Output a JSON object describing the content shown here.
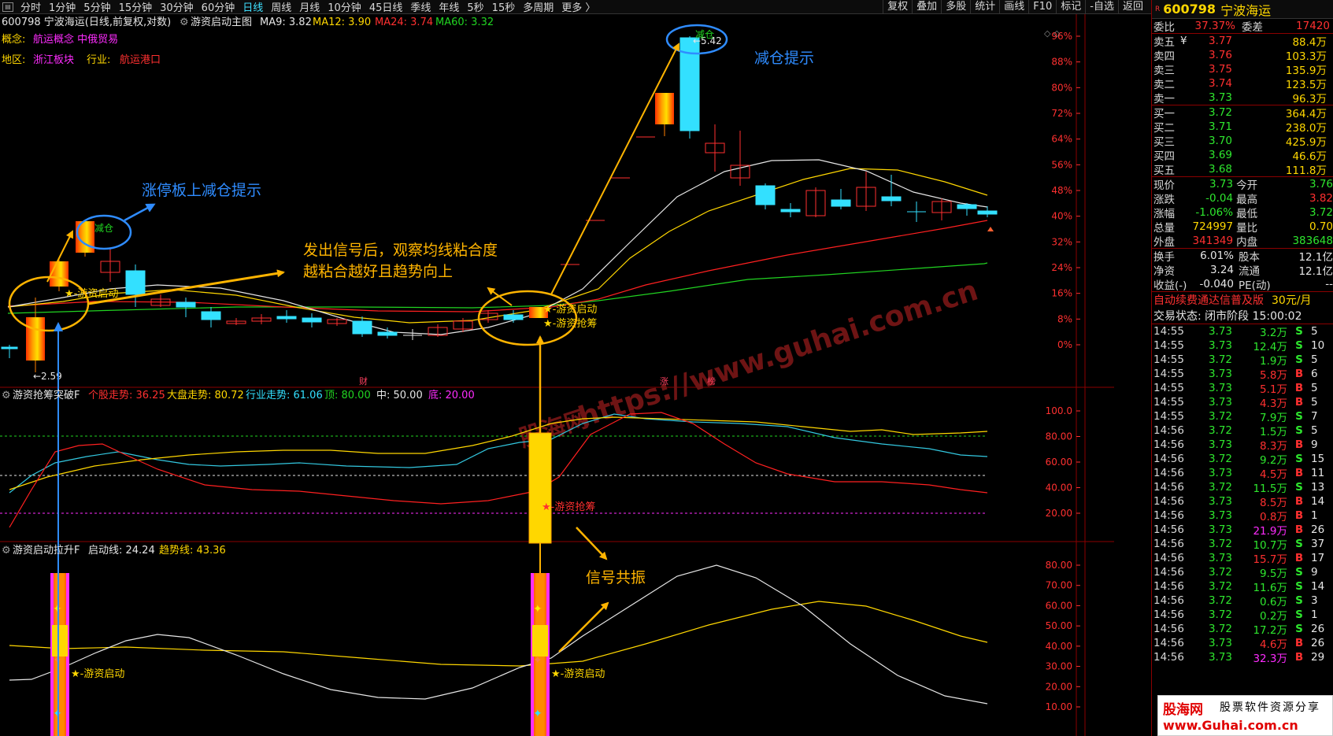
{
  "topbar": {
    "periods": [
      "分时",
      "1分钟",
      "5分钟",
      "15分钟",
      "30分钟",
      "60分钟",
      "日线",
      "周线",
      "月线",
      "10分钟",
      "45日线",
      "季线",
      "年线",
      "5秒",
      "15秒",
      "多周期",
      "更多 〉"
    ],
    "active_period": "日线",
    "tools": [
      "复权",
      "叠加",
      "多股",
      "统计",
      "画线",
      "F10",
      "标记",
      "-自选",
      "返回"
    ]
  },
  "chart": {
    "header": {
      "code_name": "600798 宁波海运(日线,前复权,对数)",
      "indicator": "游资启动主图",
      "ma9": "MA9: 3.82",
      "ma12": "MA12: 3.90",
      "ma24": "MA24: 3.74",
      "ma60": "MA60: 3.32"
    },
    "concept_label": "概念:",
    "concept_value": "航运概念 中俄贸易",
    "region_label": "地区:",
    "region_value": "浙江板块",
    "industry_label": "行业:",
    "industry_value": "航运港口",
    "price_axis": [
      "96%",
      "88%",
      "80%",
      "72%",
      "64%",
      "56%",
      "48%",
      "40%",
      "32%",
      "24%",
      "16%",
      "8%",
      "0%"
    ],
    "low_label": "←2.59",
    "high_label": "←5.42",
    "reduce_label": "减仓",
    "signal_start": "★-游资启动",
    "signal_grab": "★-游资抢筹",
    "markers": [
      "财",
      "涨",
      "榜"
    ],
    "watermark": "https://www.guhai.com.cn",
    "watermark_small": "股海网"
  },
  "annotations": {
    "limit_up_reduce": "涨停板上减仓提示",
    "reduce_hint": "减仓提示",
    "observe_line1": "发出信号后，观察均线粘合度",
    "observe_line2": "越粘合越好且趋势向上",
    "resonance": "信号共振"
  },
  "panel2": {
    "title": "游资抢筹突破F",
    "stock_trend": "个股走势: 36.25",
    "market_trend": "大盘走势: 80.72",
    "industry_trend": "行业走势: 61.06",
    "top": "顶: 80.00",
    "mid": "中: 50.00",
    "bottom": "底: 20.00",
    "axis": [
      "100.0",
      "80.00",
      "60.00",
      "40.00",
      "20.00"
    ]
  },
  "panel3": {
    "title": "游资启动拉升F",
    "start_line": "启动线: 24.24",
    "trend_line": "趋势线: 43.36",
    "axis": [
      "80.00",
      "70.00",
      "60.00",
      "50.00",
      "40.00",
      "30.00",
      "20.00",
      "10.00"
    ]
  },
  "quote": {
    "code": "600798",
    "name": "宁波海运",
    "r_mark": "R",
    "weibi_label": "委比",
    "weibi": "37.37%",
    "weicha_label": "委差",
    "weicha": "17420",
    "sell": [
      {
        "label": "卖五",
        "mark": "¥",
        "price": "3.77",
        "vol": "88.4万"
      },
      {
        "label": "卖四",
        "mark": "",
        "price": "3.76",
        "vol": "103.3万"
      },
      {
        "label": "卖三",
        "mark": "",
        "price": "3.75",
        "vol": "135.9万"
      },
      {
        "label": "卖二",
        "mark": "",
        "price": "3.74",
        "vol": "123.5万"
      },
      {
        "label": "卖一",
        "mark": "",
        "price": "3.73",
        "vol": "96.3万"
      }
    ],
    "buy": [
      {
        "label": "买一",
        "price": "3.72",
        "vol": "364.4万"
      },
      {
        "label": "买二",
        "price": "3.71",
        "vol": "238.0万"
      },
      {
        "label": "买三",
        "price": "3.70",
        "vol": "425.9万"
      },
      {
        "label": "买四",
        "price": "3.69",
        "vol": "46.6万"
      },
      {
        "label": "买五",
        "price": "3.68",
        "vol": "111.8万"
      }
    ],
    "stats": [
      {
        "l1": "现价",
        "v1": "3.73",
        "c1": "grn",
        "l2": "今开",
        "v2": "3.76",
        "c2": "grn"
      },
      {
        "l1": "涨跌",
        "v1": "-0.04",
        "c1": "grn",
        "l2": "最高",
        "v2": "3.82",
        "c2": "red"
      },
      {
        "l1": "涨幅",
        "v1": "-1.06%",
        "c1": "grn",
        "l2": "最低",
        "v2": "3.72",
        "c2": "grn"
      },
      {
        "l1": "总量",
        "v1": "724997",
        "c1": "yel",
        "l2": "量比",
        "v2": "0.70",
        "c2": "yel"
      },
      {
        "l1": "外盘",
        "v1": "341349",
        "c1": "red",
        "l2": "内盘",
        "v2": "383648",
        "c2": "grn"
      }
    ],
    "stats2": [
      {
        "l1": "换手",
        "v1": "6.01%",
        "l2": "股本",
        "v2": "12.1亿"
      },
      {
        "l1": "净资",
        "v1": "3.24",
        "l2": "流通",
        "v2": "12.1亿"
      },
      {
        "l1": "收益(-)",
        "v1": "-0.040",
        "l2": "PE(动)",
        "v2": "--"
      }
    ],
    "promo": "自动续费通达信普及版",
    "promo_price": "30元/月",
    "trade_state": "交易状态: 闭市阶段 15:00:02"
  },
  "ticks": [
    {
      "t": "14:55",
      "p": "3.73",
      "pc": "grn",
      "v": "3.2万",
      "vc": "grn",
      "bs": "S",
      "n": "5"
    },
    {
      "t": "14:55",
      "p": "3.73",
      "pc": "grn",
      "v": "12.4万",
      "vc": "grn",
      "bs": "S",
      "n": "10"
    },
    {
      "t": "14:55",
      "p": "3.72",
      "pc": "grn",
      "v": "1.9万",
      "vc": "grn",
      "bs": "S",
      "n": "5"
    },
    {
      "t": "14:55",
      "p": "3.73",
      "pc": "grn",
      "v": "5.8万",
      "vc": "red",
      "bs": "B",
      "n": "6"
    },
    {
      "t": "14:55",
      "p": "3.73",
      "pc": "grn",
      "v": "5.1万",
      "vc": "red",
      "bs": "B",
      "n": "5"
    },
    {
      "t": "14:55",
      "p": "3.73",
      "pc": "grn",
      "v": "4.3万",
      "vc": "red",
      "bs": "B",
      "n": "5"
    },
    {
      "t": "14:55",
      "p": "3.72",
      "pc": "grn",
      "v": "7.9万",
      "vc": "grn",
      "bs": "S",
      "n": "7"
    },
    {
      "t": "14:56",
      "p": "3.72",
      "pc": "grn",
      "v": "1.5万",
      "vc": "grn",
      "bs": "S",
      "n": "5"
    },
    {
      "t": "14:56",
      "p": "3.73",
      "pc": "grn",
      "v": "8.3万",
      "vc": "red",
      "bs": "B",
      "n": "9"
    },
    {
      "t": "14:56",
      "p": "3.72",
      "pc": "grn",
      "v": "9.2万",
      "vc": "grn",
      "bs": "S",
      "n": "15"
    },
    {
      "t": "14:56",
      "p": "3.73",
      "pc": "grn",
      "v": "4.5万",
      "vc": "red",
      "bs": "B",
      "n": "11"
    },
    {
      "t": "14:56",
      "p": "3.72",
      "pc": "grn",
      "v": "11.5万",
      "vc": "grn",
      "bs": "S",
      "n": "13"
    },
    {
      "t": "14:56",
      "p": "3.73",
      "pc": "grn",
      "v": "8.5万",
      "vc": "red",
      "bs": "B",
      "n": "14"
    },
    {
      "t": "14:56",
      "p": "3.73",
      "pc": "grn",
      "v": "0.8万",
      "vc": "red",
      "bs": "B",
      "n": "1"
    },
    {
      "t": "14:56",
      "p": "3.73",
      "pc": "grn",
      "v": "21.9万",
      "vc": "mag",
      "bs": "B",
      "n": "26"
    },
    {
      "t": "14:56",
      "p": "3.72",
      "pc": "grn",
      "v": "10.7万",
      "vc": "grn",
      "bs": "S",
      "n": "37"
    },
    {
      "t": "14:56",
      "p": "3.73",
      "pc": "grn",
      "v": "15.7万",
      "vc": "red",
      "bs": "B",
      "n": "17"
    },
    {
      "t": "14:56",
      "p": "3.72",
      "pc": "grn",
      "v": "9.5万",
      "vc": "grn",
      "bs": "S",
      "n": "9"
    },
    {
      "t": "14:56",
      "p": "3.72",
      "pc": "grn",
      "v": "11.6万",
      "vc": "grn",
      "bs": "S",
      "n": "14"
    },
    {
      "t": "14:56",
      "p": "3.72",
      "pc": "grn",
      "v": "0.6万",
      "vc": "grn",
      "bs": "S",
      "n": "3"
    },
    {
      "t": "14:56",
      "p": "3.72",
      "pc": "grn",
      "v": "0.2万",
      "vc": "grn",
      "bs": "S",
      "n": "1"
    },
    {
      "t": "14:56",
      "p": "3.72",
      "pc": "grn",
      "v": "17.2万",
      "vc": "grn",
      "bs": "S",
      "n": "26"
    },
    {
      "t": "14:56",
      "p": "3.73",
      "pc": "grn",
      "v": "4.6万",
      "vc": "red",
      "bs": "B",
      "n": "26"
    },
    {
      "t": "14:56",
      "p": "3.73",
      "pc": "grn",
      "v": "32.3万",
      "vc": "mag",
      "bs": "B",
      "n": "29"
    }
  ],
  "brand": {
    "a": "股海网",
    "b": "股票软件资源分享",
    "c": "www.Guhai.com.cn"
  },
  "colors": {
    "up": "#ff3030",
    "down": "#33e0ff",
    "ma9": "#e6e6e6",
    "ma12": "#ffd700",
    "ma24": "#ff2020",
    "ma60": "#21d421",
    "annot_blue": "#2f8cff",
    "annot_yellow": "#ffb400"
  }
}
